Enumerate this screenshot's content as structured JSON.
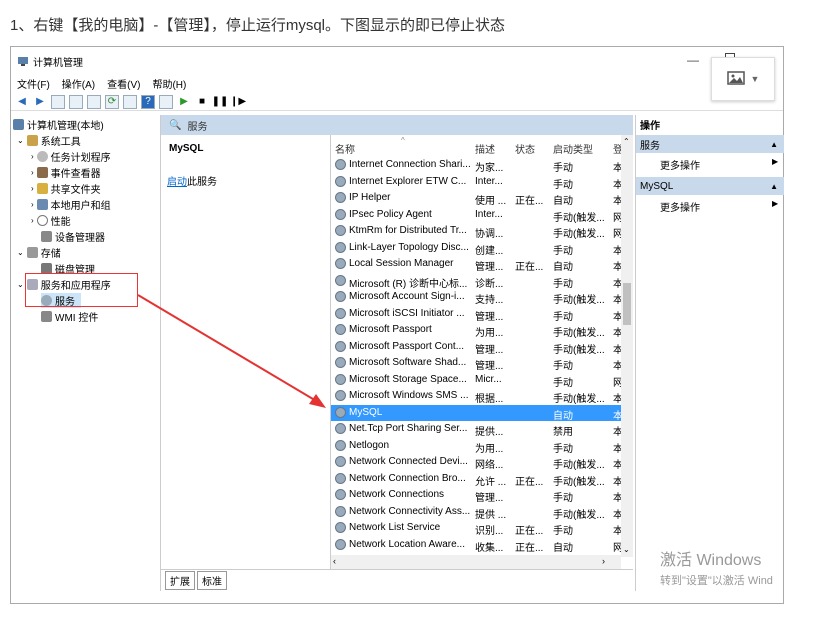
{
  "caption": "1、右键【我的电脑】-【管理】，停止运行mysql。下图显示的即已停止状态",
  "window": {
    "title": "计算机管理",
    "menu": [
      "文件(F)",
      "操作(A)",
      "查看(V)",
      "帮助(H)"
    ]
  },
  "tree": {
    "items": [
      {
        "label": "计算机管理(本地)"
      },
      {
        "label": "系统工具"
      },
      {
        "label": "任务计划程序"
      },
      {
        "label": "事件查看器"
      },
      {
        "label": "共享文件夹"
      },
      {
        "label": "本地用户和组"
      },
      {
        "label": "性能"
      },
      {
        "label": "设备管理器"
      },
      {
        "label": "存储"
      },
      {
        "label": "磁盘管理"
      },
      {
        "label": "服务和应用程序"
      },
      {
        "label": "服务"
      },
      {
        "label": "WMI 控件"
      }
    ]
  },
  "services": {
    "header": "服务",
    "selected_name": "MySQL",
    "link": "启动",
    "link_suffix": "此服务",
    "columns": [
      "名称",
      "描述",
      "状态",
      "启动类型",
      "登"
    ],
    "rows": [
      {
        "name": "Internet Connection Shari...",
        "desc": "为家...",
        "status": "",
        "type": "手动",
        "logon": "本"
      },
      {
        "name": "Internet Explorer ETW C...",
        "desc": "Inter...",
        "status": "",
        "type": "手动",
        "logon": "本"
      },
      {
        "name": "IP Helper",
        "desc": "使用 ...",
        "status": "正在...",
        "type": "自动",
        "logon": "本"
      },
      {
        "name": "IPsec Policy Agent",
        "desc": "Inter...",
        "status": "",
        "type": "手动(触发...",
        "logon": "网"
      },
      {
        "name": "KtmRm for Distributed Tr...",
        "desc": "协调...",
        "status": "",
        "type": "手动(触发...",
        "logon": "网"
      },
      {
        "name": "Link-Layer Topology Disc...",
        "desc": "创建...",
        "status": "",
        "type": "手动",
        "logon": "本"
      },
      {
        "name": "Local Session Manager",
        "desc": "管理...",
        "status": "正在...",
        "type": "自动",
        "logon": "本"
      },
      {
        "name": "Microsoft (R) 诊断中心标...",
        "desc": "诊断...",
        "status": "",
        "type": "手动",
        "logon": "本"
      },
      {
        "name": "Microsoft Account Sign-i...",
        "desc": "支持...",
        "status": "",
        "type": "手动(触发...",
        "logon": "本"
      },
      {
        "name": "Microsoft iSCSI Initiator ...",
        "desc": "管理...",
        "status": "",
        "type": "手动",
        "logon": "本"
      },
      {
        "name": "Microsoft Passport",
        "desc": "为用...",
        "status": "",
        "type": "手动(触发...",
        "logon": "本"
      },
      {
        "name": "Microsoft Passport Cont...",
        "desc": "管理...",
        "status": "",
        "type": "手动(触发...",
        "logon": "本"
      },
      {
        "name": "Microsoft Software Shad...",
        "desc": "管理...",
        "status": "",
        "type": "手动",
        "logon": "本"
      },
      {
        "name": "Microsoft Storage Space...",
        "desc": "Micr...",
        "status": "",
        "type": "手动",
        "logon": "网"
      },
      {
        "name": "Microsoft Windows SMS ...",
        "desc": "根据...",
        "status": "",
        "type": "手动(触发...",
        "logon": "本"
      },
      {
        "name": "MySQL",
        "desc": "",
        "status": "",
        "type": "自动",
        "logon": "本",
        "selected": true
      },
      {
        "name": "Net.Tcp Port Sharing Ser...",
        "desc": "提供...",
        "status": "",
        "type": "禁用",
        "logon": "本"
      },
      {
        "name": "Netlogon",
        "desc": "为用...",
        "status": "",
        "type": "手动",
        "logon": "本"
      },
      {
        "name": "Network Connected Devi...",
        "desc": "网络...",
        "status": "",
        "type": "手动(触发...",
        "logon": "本"
      },
      {
        "name": "Network Connection Bro...",
        "desc": "允许 ...",
        "status": "正在...",
        "type": "手动(触发...",
        "logon": "本"
      },
      {
        "name": "Network Connections",
        "desc": "管理...",
        "status": "",
        "type": "手动",
        "logon": "本"
      },
      {
        "name": "Network Connectivity Ass...",
        "desc": "提供 ...",
        "status": "",
        "type": "手动(触发...",
        "logon": "本"
      },
      {
        "name": "Network List Service",
        "desc": "识别...",
        "status": "正在...",
        "type": "手动",
        "logon": "本"
      },
      {
        "name": "Network Location Aware...",
        "desc": "收集...",
        "status": "正在...",
        "type": "自动",
        "logon": "网"
      }
    ],
    "tabs": [
      "扩展",
      "标准"
    ]
  },
  "actions": {
    "title": "操作",
    "sections": [
      {
        "header": "服务",
        "item": "更多操作"
      },
      {
        "header": "MySQL",
        "item": "更多操作"
      }
    ]
  },
  "watermark": {
    "line1": "激活 Windows",
    "line2": "转到\"设置\"以激活 Wind"
  },
  "colors": {
    "selection": "#3399ff",
    "pane_header": "#c9d9ec",
    "annotation": "#e33333",
    "link": "#0066cc"
  }
}
